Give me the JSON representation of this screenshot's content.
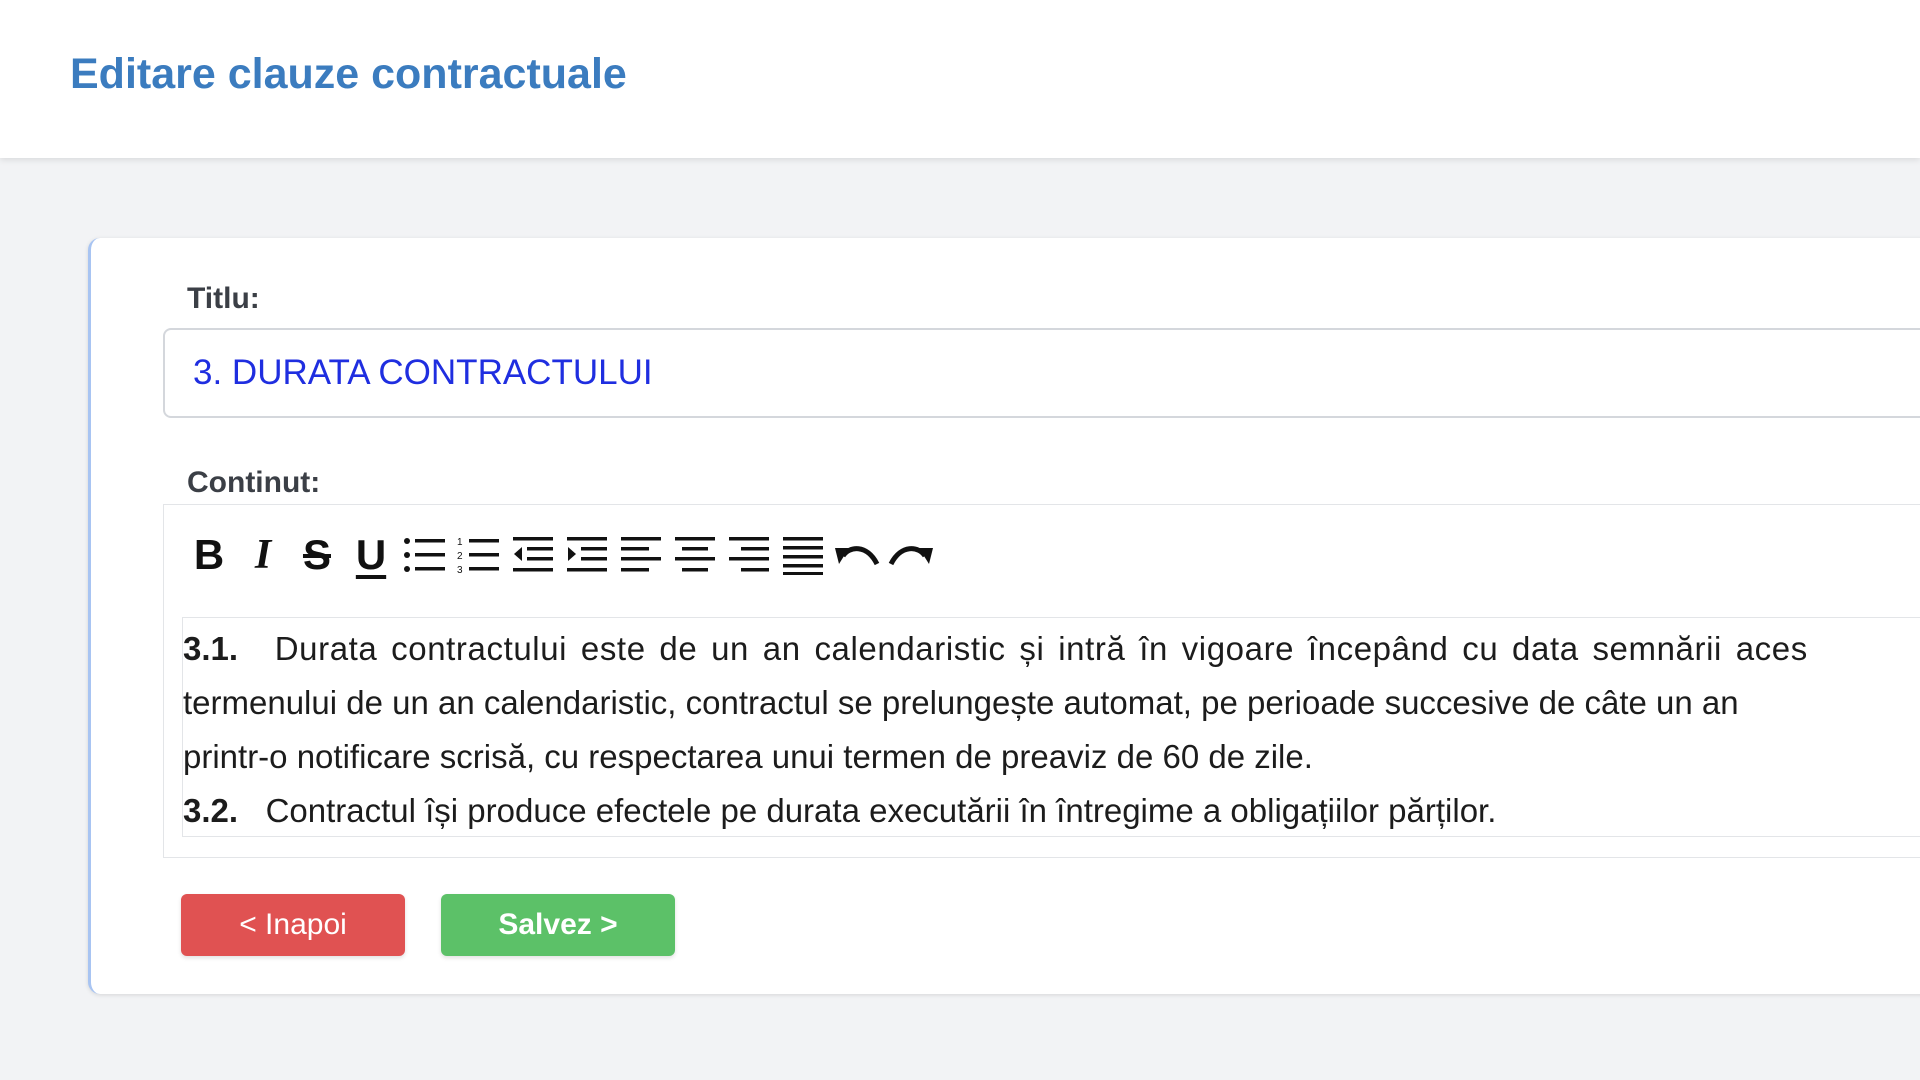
{
  "header": {
    "title": "Editare clauze contractuale"
  },
  "form": {
    "title_label": "Titlu:",
    "title_value": "3. DURATA CONTRACTULUI",
    "content_label": "Continut:",
    "content": {
      "lines": [
        {
          "num": "3.1.",
          "text": "Durata contractului este de un an calendaristic și intră în vigoare începând cu data semnării aces"
        },
        {
          "num": "",
          "text": "termenului de un an calendaristic, contractul se prelungește automat, pe perioade succesive de câte un an"
        },
        {
          "num": "",
          "text": "printr-o notificare scrisă, cu respectarea unui termen de preaviz de 60 de zile."
        },
        {
          "num": "3.2.",
          "text": "Contractul își produce efectele pe durata executării în întregime a obligațiilor părților."
        }
      ]
    }
  },
  "toolbar": {
    "bold": "B",
    "italic": "I",
    "strike": "S",
    "underline": "U",
    "icons": [
      "bold-icon",
      "italic-icon",
      "strikethrough-icon",
      "underline-icon",
      "bullet-list-icon",
      "numbered-list-icon",
      "outdent-icon",
      "indent-icon",
      "align-left-icon",
      "align-center-icon",
      "align-right-icon",
      "align-justify-icon",
      "undo-icon",
      "redo-icon"
    ]
  },
  "buttons": {
    "back": "< Inapoi",
    "save": "Salvez >"
  },
  "colors": {
    "title": "#3b7cbf",
    "input_text": "#1f2ee0",
    "back_button": "#e05252",
    "save_button": "#5cc168"
  }
}
